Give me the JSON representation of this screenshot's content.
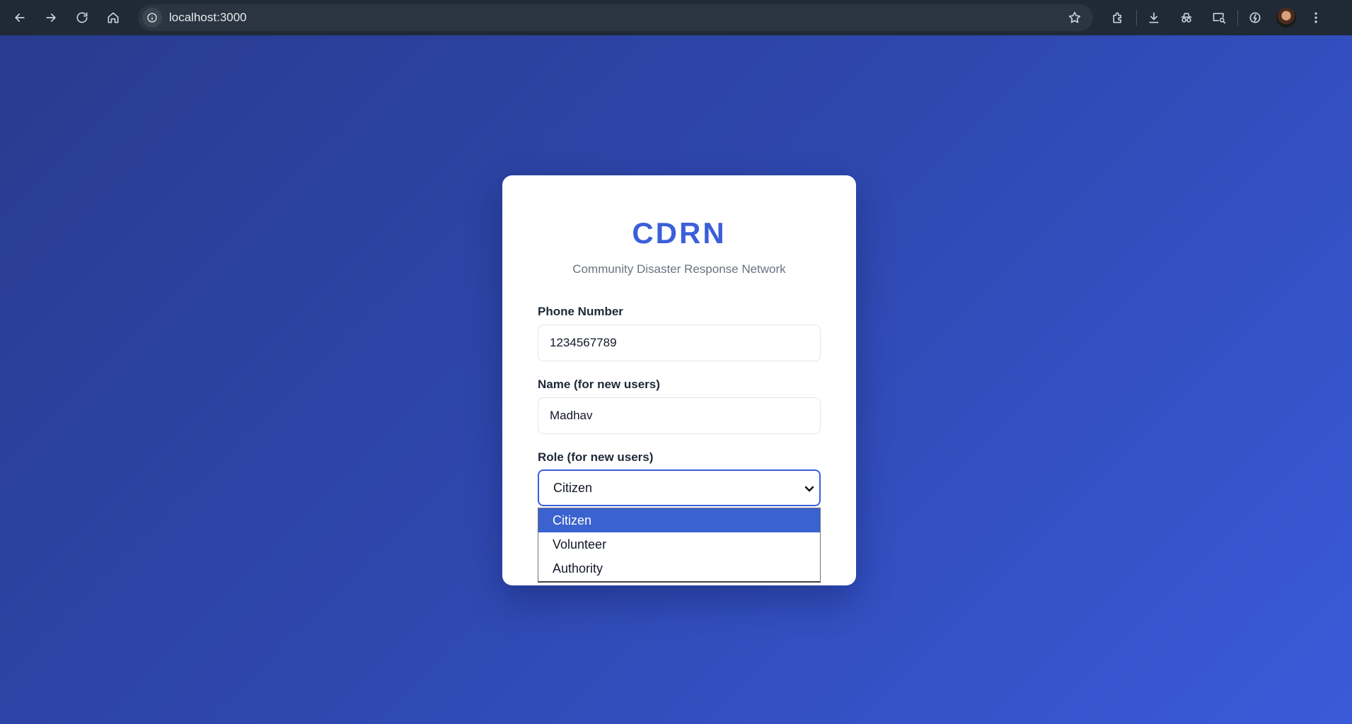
{
  "browser": {
    "url": "localhost:3000"
  },
  "app": {
    "title": "CDRN",
    "subtitle": "Community Disaster Response Network"
  },
  "form": {
    "phone": {
      "label": "Phone Number",
      "value": "1234567789"
    },
    "name": {
      "label": "Name (for new users)",
      "value": "Madhav"
    },
    "role": {
      "label": "Role (for new users)",
      "selected": "Citizen",
      "options": [
        "Citizen",
        "Volunteer",
        "Authority"
      ]
    }
  },
  "colors": {
    "accent": "#3b5fd9",
    "background_start": "#283b8e",
    "background_end": "#3a5ad9",
    "option_highlight": "#3b63cf"
  }
}
